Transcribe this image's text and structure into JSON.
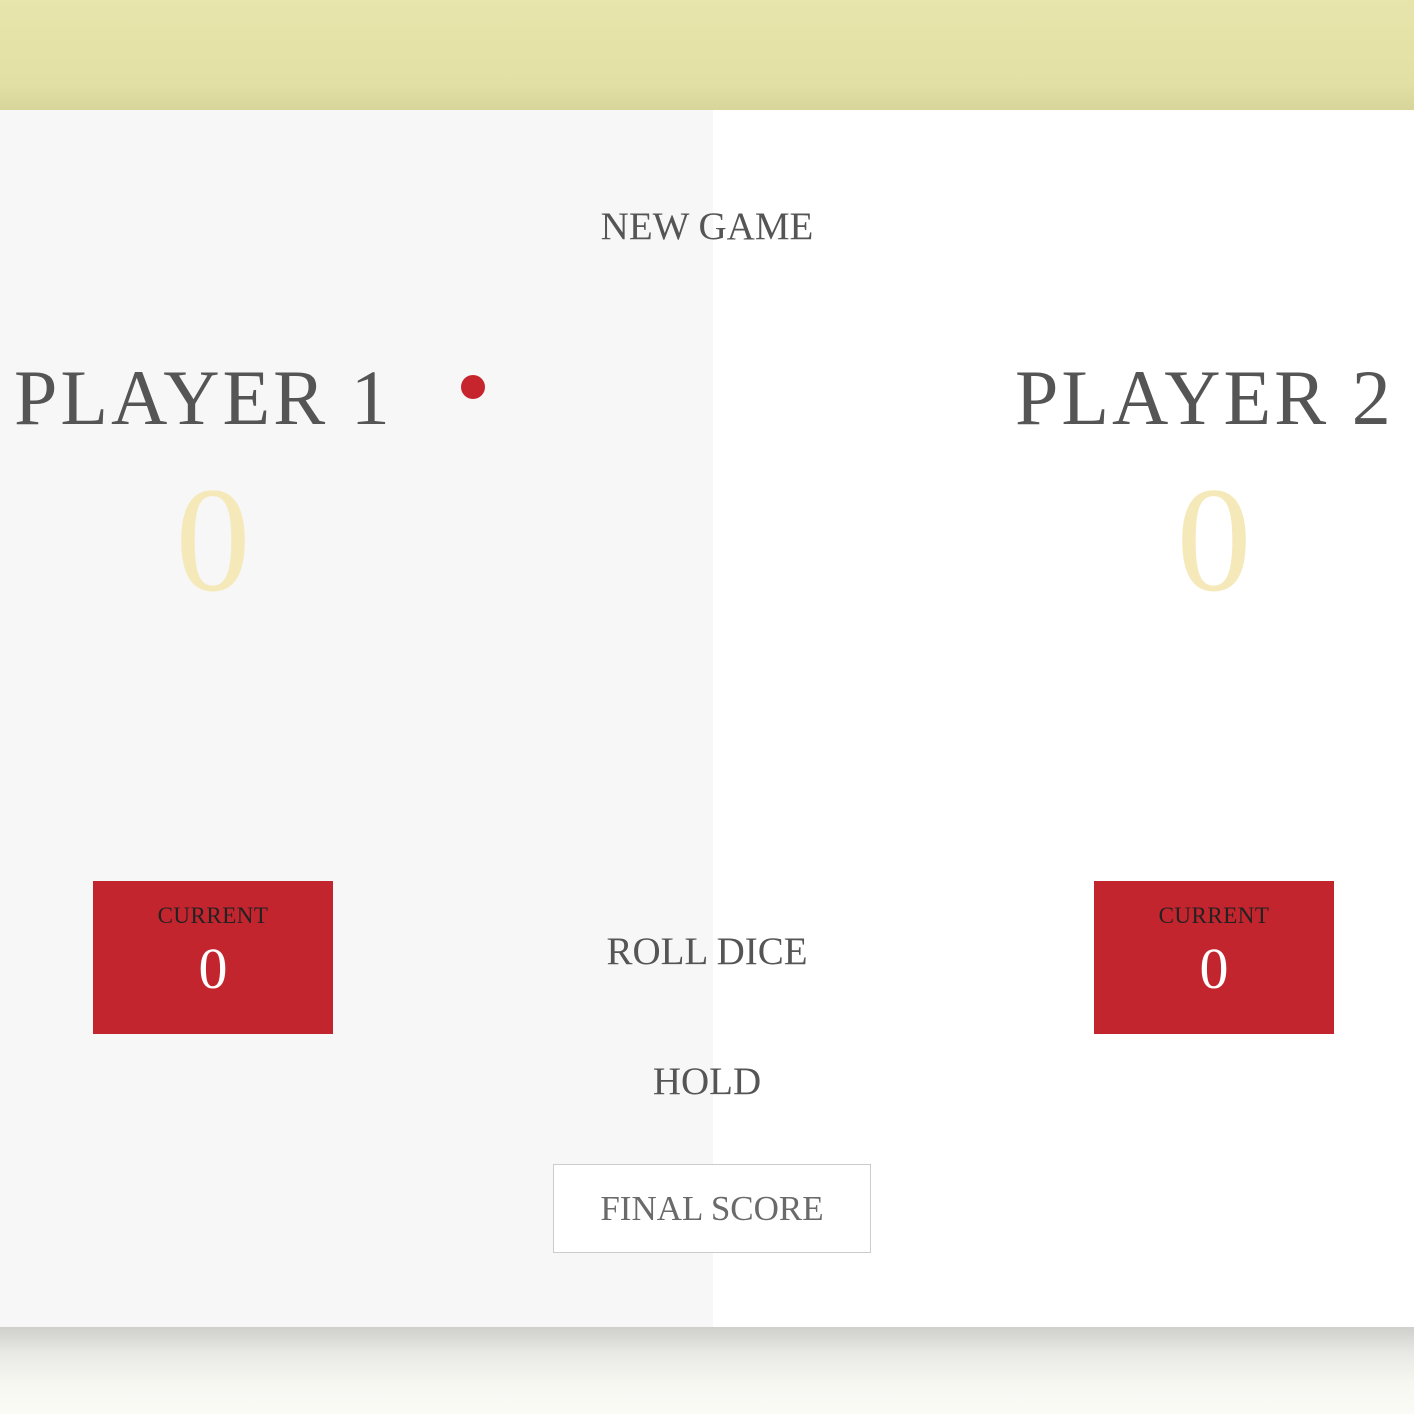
{
  "players": [
    {
      "name": "PLAYER 1",
      "score": "0",
      "current_label": "CURRENT",
      "current_score": "0",
      "active": true
    },
    {
      "name": "PLAYER 2",
      "score": "0",
      "current_label": "CURRENT",
      "current_score": "0",
      "active": false
    }
  ],
  "controls": {
    "new_game": "NEW GAME",
    "roll_dice": "ROLL DICE",
    "hold": "HOLD",
    "final_score_placeholder": "FINAL SCORE"
  },
  "colors": {
    "accent": "#c2252d",
    "score": "#f5e9ba",
    "text": "#555555",
    "top_band": "#e6e4a9",
    "active_panel": "#f7f7f7"
  }
}
